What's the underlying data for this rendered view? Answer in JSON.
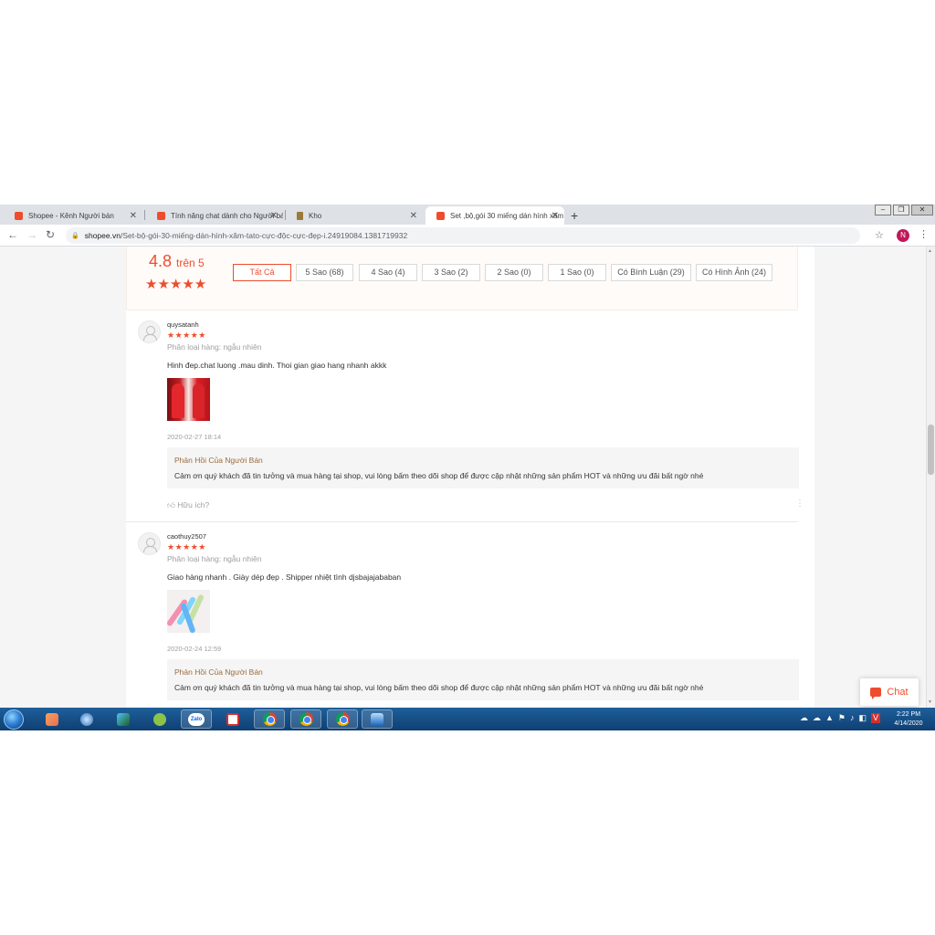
{
  "browser": {
    "tabs": [
      {
        "title": "Shopee - Kênh Người bán",
        "icon": "shopee-icon"
      },
      {
        "title": "Tính năng chat dành cho Người bán",
        "icon": "shopee-icon"
      },
      {
        "title": "Kho",
        "icon": "kho-icon"
      },
      {
        "title": "Set ,bộ,gói 30 miếng dán hình xăm",
        "icon": "shopee-icon"
      }
    ],
    "url_host": "shopee.vn",
    "url_path": "/Set-bộ-gói-30-miếng-dán-hình-xăm-tato-cực-độc-cực-đẹp-i.24919084.1381719932",
    "profile_initial": "N"
  },
  "rating": {
    "score": "4.8",
    "out_of": "trên 5",
    "stars": "★★★★★",
    "filters": [
      "Tất Cả",
      "5 Sao (68)",
      "4 Sao (4)",
      "3 Sao (2)",
      "2 Sao (0)",
      "1 Sao (0)",
      "Có Bình Luận (29)",
      "Có Hình Ảnh (24)"
    ]
  },
  "reviews": [
    {
      "username": "quysatanh",
      "stars": "★★★★★",
      "variant": "Phân loại hàng: ngẫu nhiên",
      "comment": "Hinh đep.chat luong .mau dinh. Thoi gian giao hang nhanh akkk",
      "date": "2020-02-27 18:14",
      "reply_title": "Phản Hồi Của Người Bán",
      "reply_text": "Cảm ơn quý khách đã tin tưởng và mua hàng tại shop, vui lòng bấm theo dõi shop để được cập nhật những sản phẩm HOT và những ưu đãi bất ngờ nhé",
      "helpful": "Hữu ích?"
    },
    {
      "username": "caothuy2507",
      "stars": "★★★★★",
      "variant": "Phân loại hàng: ngẫu nhiên",
      "comment": "Giao hàng nhanh . Giày dép đẹp . Shipper nhiệt tình djsbajajababan",
      "date": "2020-02-24 12:59",
      "reply_title": "Phản Hồi Của Người Bán",
      "reply_text": "Cảm ơn quý khách đã tin tưởng và mua hàng tại shop, vui lòng bấm theo dõi shop để được cập nhật những sản phẩm HOT và những ưu đãi bất ngờ nhé"
    }
  ],
  "chat_label": "Chat",
  "taskbar": {
    "zalo_label": "Zalo",
    "time": "2:22 PM",
    "date": "4/14/2020"
  },
  "colors": {
    "brand": "#ee4d2d",
    "taskbar": "#1e5f9a"
  }
}
